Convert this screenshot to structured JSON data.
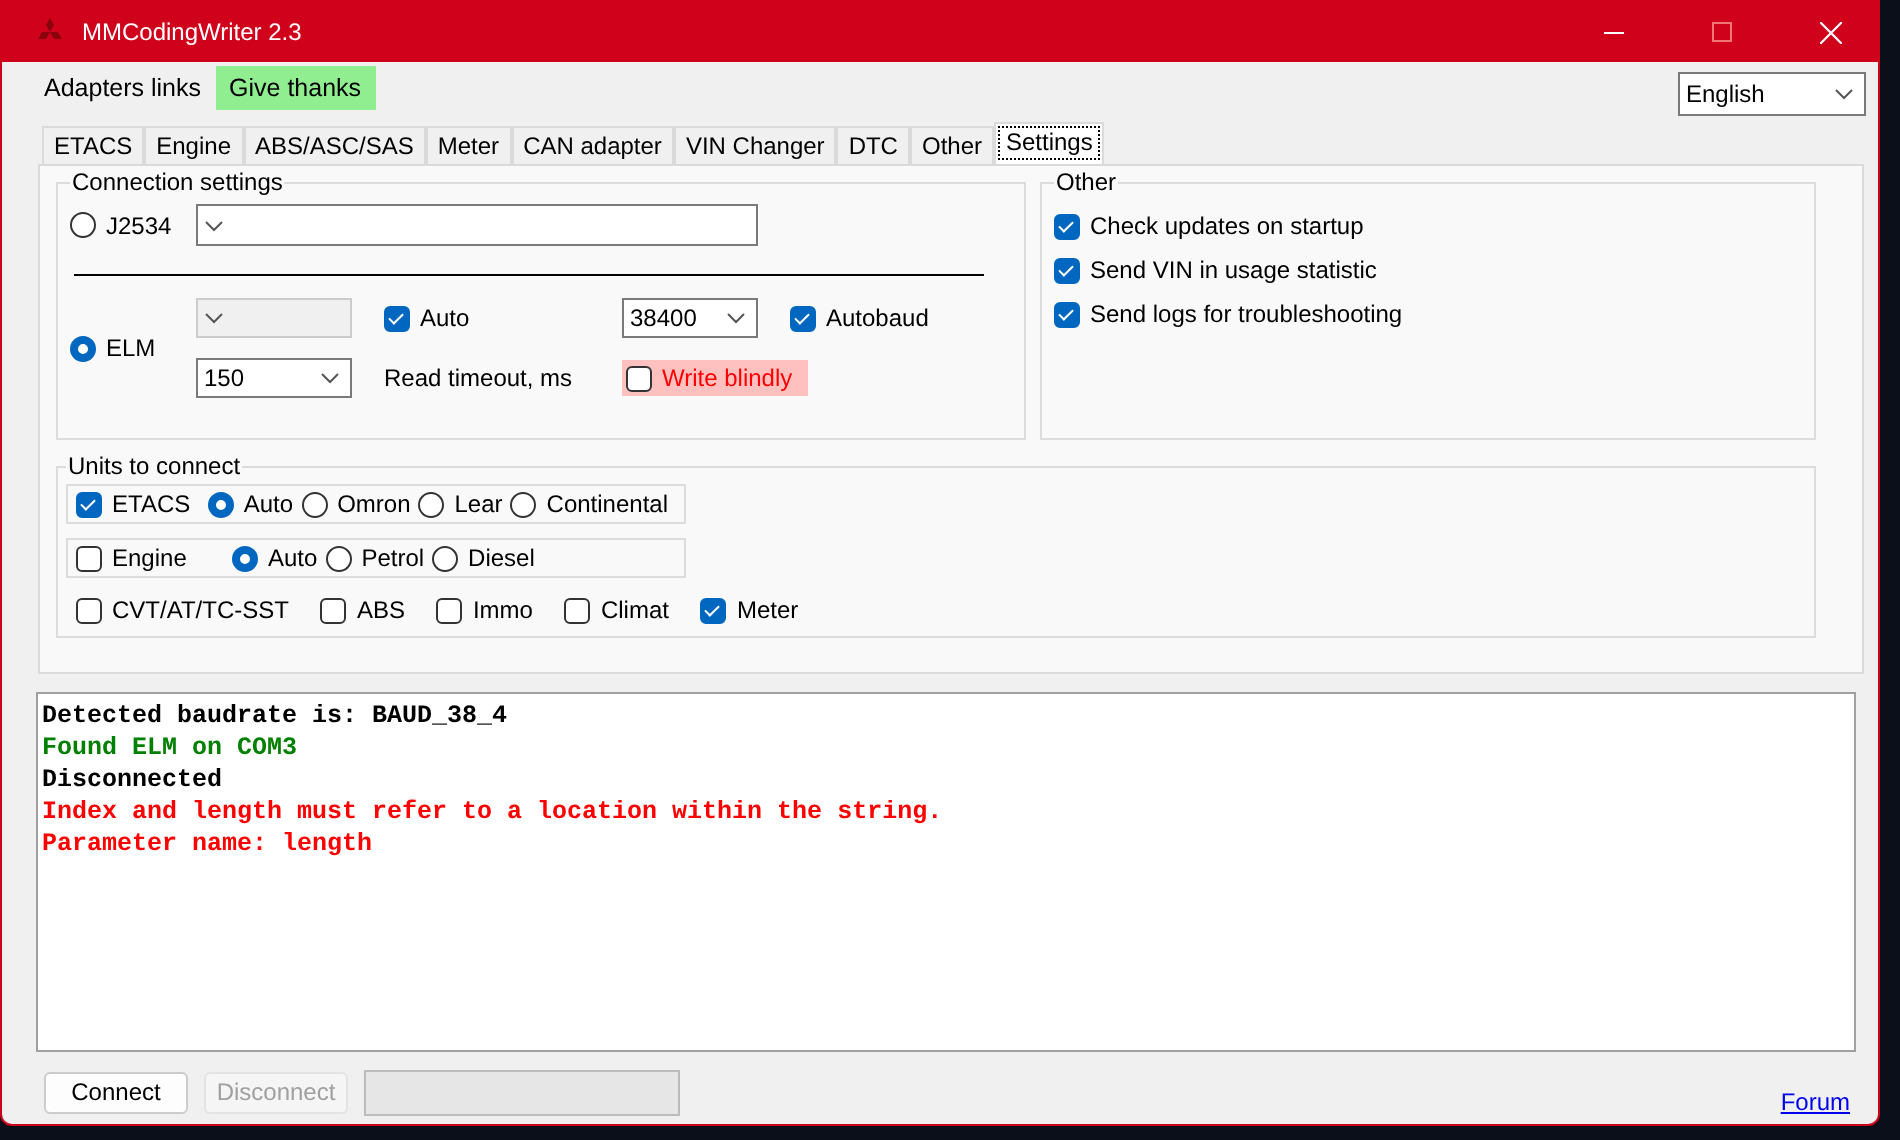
{
  "window": {
    "title": "MMCodingWriter 2.3"
  },
  "menu": [
    {
      "label": "Adapters links",
      "highlighted": false
    },
    {
      "label": "Give thanks",
      "highlighted": true
    }
  ],
  "language": {
    "value": "English"
  },
  "tabs": [
    {
      "label": "ETACS",
      "selected": false
    },
    {
      "label": "Engine",
      "selected": false
    },
    {
      "label": "ABS/ASC/SAS",
      "selected": false
    },
    {
      "label": "Meter",
      "selected": false
    },
    {
      "label": "CAN adapter",
      "selected": false
    },
    {
      "label": "VIN Changer",
      "selected": false
    },
    {
      "label": "DTC",
      "selected": false
    },
    {
      "label": "Other",
      "selected": false
    },
    {
      "label": "Settings",
      "selected": true
    }
  ],
  "connection": {
    "title": "Connection settings",
    "j2534": {
      "label": "J2534",
      "selected": false
    },
    "elm": {
      "label": "ELM",
      "selected": true
    },
    "port": {
      "disabled": true
    },
    "auto": {
      "label": "Auto",
      "checked": true
    },
    "baud": {
      "value": "38400"
    },
    "autobaud": {
      "label": "Autobaud",
      "checked": true
    },
    "timeout": {
      "value": "150",
      "label": "Read timeout, ms"
    },
    "write_blindly": {
      "label": "Write blindly",
      "checked": false
    }
  },
  "other": {
    "title": "Other",
    "options": [
      {
        "label": "Check updates on startup",
        "checked": true
      },
      {
        "label": "Send VIN in usage statistic",
        "checked": true
      },
      {
        "label": "Send logs for troubleshooting",
        "checked": true
      }
    ]
  },
  "units": {
    "title": "Units to connect",
    "groups": [
      {
        "label": "ETACS",
        "checked": true,
        "options": [
          {
            "label": "Auto",
            "selected": true
          },
          {
            "label": "Omron",
            "selected": false
          },
          {
            "label": "Lear",
            "selected": false
          },
          {
            "label": "Continental",
            "selected": false
          }
        ]
      },
      {
        "label": "Engine",
        "checked": false,
        "options": [
          {
            "label": "Auto",
            "selected": true
          },
          {
            "label": "Petrol",
            "selected": false
          },
          {
            "label": "Diesel",
            "selected": false
          }
        ]
      }
    ],
    "others": [
      {
        "label": "CVT/AT/TC-SST",
        "checked": false
      },
      {
        "label": "ABS",
        "checked": false
      },
      {
        "label": "Immo",
        "checked": false
      },
      {
        "label": "Climat",
        "checked": false
      },
      {
        "label": "Meter",
        "checked": true
      }
    ]
  },
  "log": [
    {
      "text": "Detected baudrate is: BAUD_38_4",
      "kind": "info"
    },
    {
      "text": "Found ELM on COM3",
      "kind": "success"
    },
    {
      "text": "Disconnected",
      "kind": "info"
    },
    {
      "text": "Index and length must refer to a location within the string.",
      "kind": "error"
    },
    {
      "text": "Parameter name: length",
      "kind": "error"
    }
  ],
  "buttons": [
    {
      "label": "Connect",
      "disabled": false
    },
    {
      "label": "Disconnect",
      "disabled": true
    }
  ],
  "forum_link": "Forum"
}
